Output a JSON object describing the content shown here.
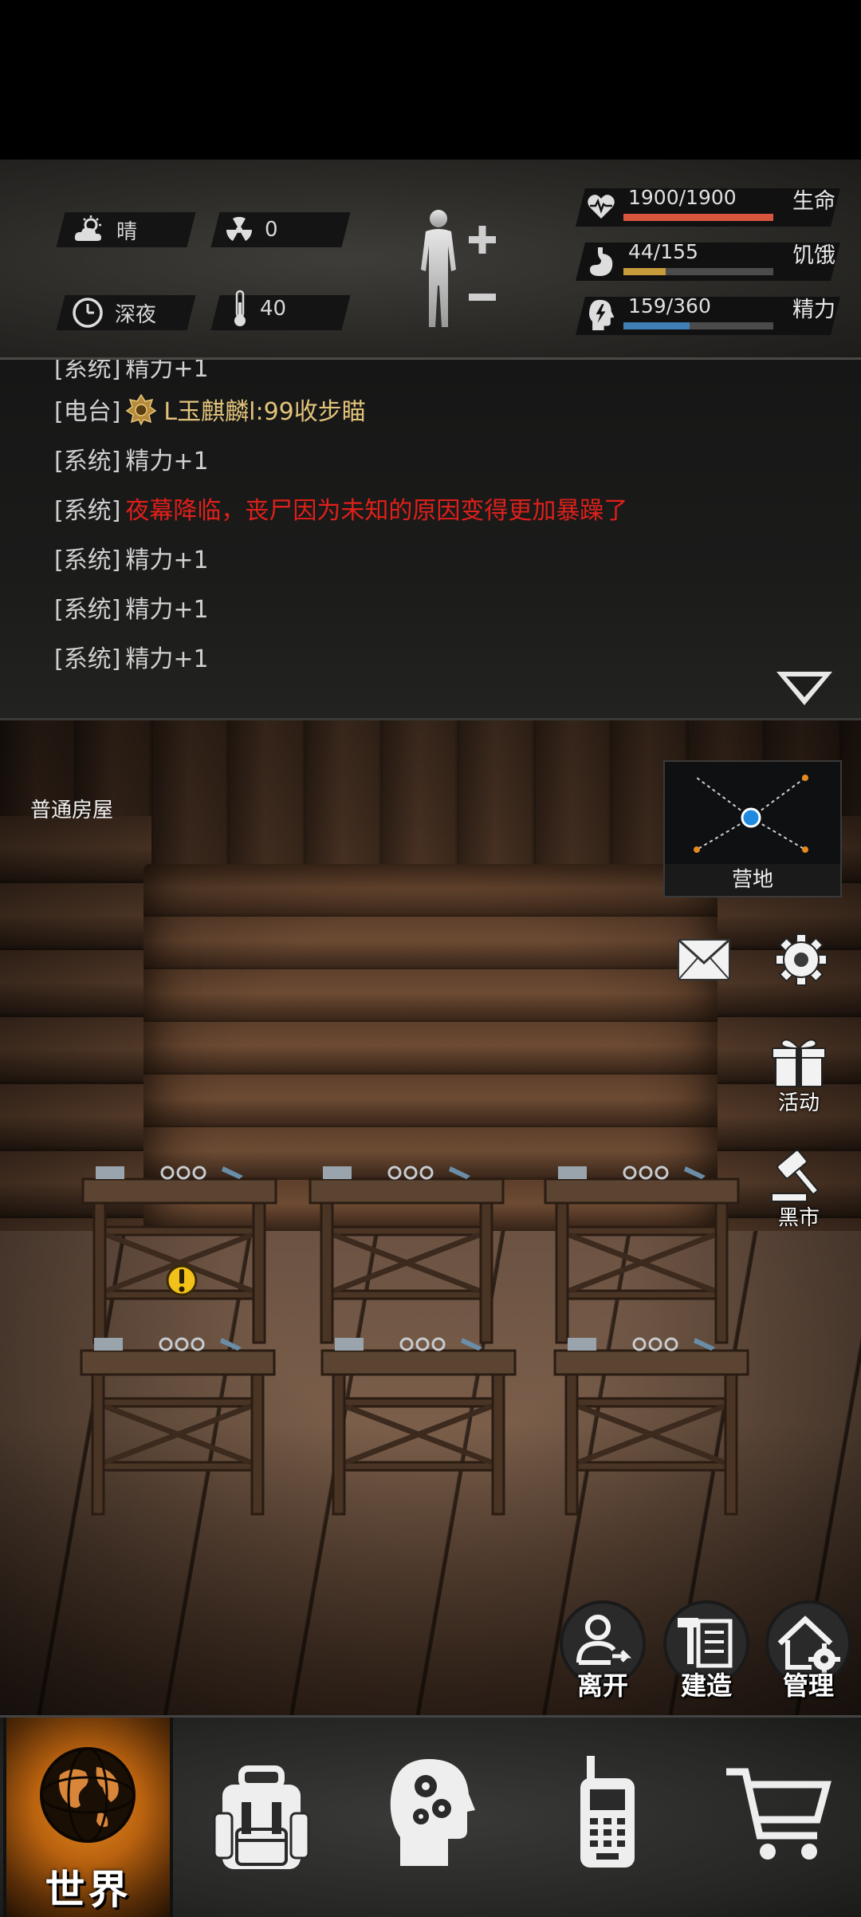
{
  "status": {
    "weather": "晴",
    "radiation": "0",
    "time_of_day": "深夜",
    "temperature": "40",
    "health": {
      "label": "生命",
      "value": "1900/1900",
      "fraction": 1.0,
      "color": "#d9553e"
    },
    "hunger": {
      "label": "饥饿",
      "value": "44/155",
      "fraction": 0.284,
      "color": "#c79a3a"
    },
    "energy": {
      "label": "精力",
      "value": "159/360",
      "fraction": 0.442,
      "color": "#3f7fb5"
    }
  },
  "log": {
    "lines": [
      {
        "tag": "[系统]",
        "text": "精力+1",
        "style": "normal"
      },
      {
        "tag": "[电台]",
        "text": "L玉麒麟l:99收步瞄",
        "style": "gold"
      },
      {
        "tag": "[系统]",
        "text": "精力+1",
        "style": "normal"
      },
      {
        "tag": "[系统]",
        "text": "夜幕降临，丧尸因为未知的原因变得更加暴躁了",
        "style": "red"
      },
      {
        "tag": "[系统]",
        "text": "精力+1",
        "style": "normal"
      },
      {
        "tag": "[系统]",
        "text": "精力+1",
        "style": "normal"
      },
      {
        "tag": "[系统]",
        "text": "精力+1",
        "style": "normal"
      }
    ]
  },
  "scene": {
    "room_name": "普通房屋",
    "minimap_label": "营地",
    "side": {
      "activity_label": "活动",
      "black_market_label": "黑市"
    },
    "actions": {
      "leave_label": "离开",
      "build_label": "建造",
      "manage_label": "管理"
    }
  },
  "nav": {
    "world_label": "世界",
    "items": [
      "backpack-icon",
      "skills-icon",
      "radio-icon",
      "shop-cart-icon"
    ]
  },
  "colors": {
    "accent_orange": "#e28a1f",
    "alert_red": "#e0201a",
    "radio_gold": "#e2c37a"
  }
}
